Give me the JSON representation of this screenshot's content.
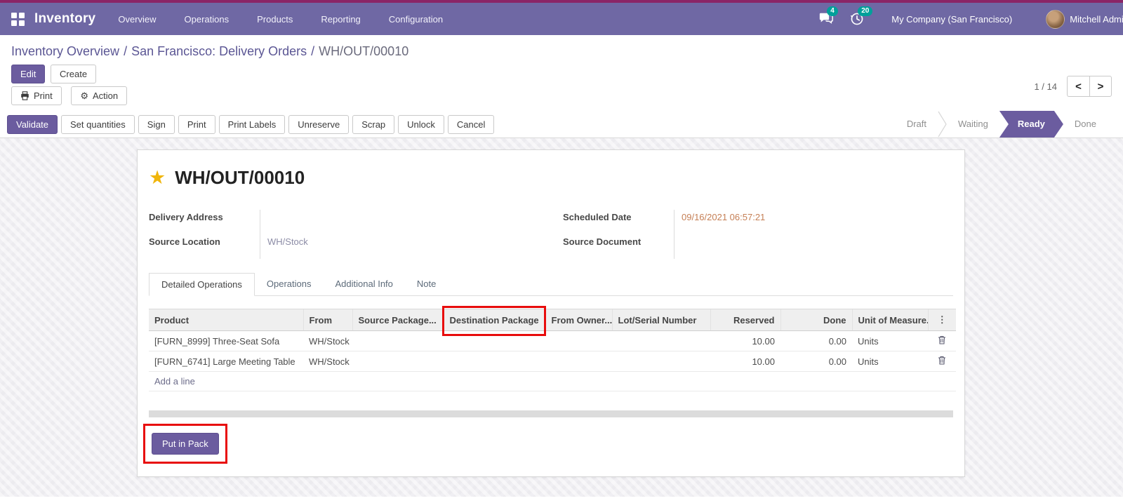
{
  "nav": {
    "app_name": "Inventory",
    "items": [
      "Overview",
      "Operations",
      "Products",
      "Reporting",
      "Configuration"
    ],
    "messages_count": "4",
    "activities_count": "20",
    "company": "My Company (San Francisco)",
    "user": "Mitchell Admin"
  },
  "breadcrumb": {
    "link1": "Inventory Overview",
    "link2": "San Francisco: Delivery Orders",
    "active": "WH/OUT/00010",
    "separator": "/"
  },
  "control": {
    "edit": "Edit",
    "create": "Create",
    "print": "Print",
    "action": "Action",
    "pager_count": "1 / 14"
  },
  "statusbar": {
    "buttons": [
      "Validate",
      "Set quantities",
      "Sign",
      "Print",
      "Print Labels",
      "Unreserve",
      "Scrap",
      "Unlock",
      "Cancel"
    ],
    "stages": [
      {
        "label": "Draft",
        "state": "inactive"
      },
      {
        "label": "Waiting",
        "state": "inactive"
      },
      {
        "label": "Ready",
        "state": "active"
      },
      {
        "label": "Done",
        "state": "inactive"
      }
    ]
  },
  "sheet": {
    "title": "WH/OUT/00010",
    "fields": {
      "delivery_address_label": "Delivery Address",
      "delivery_address_value": "",
      "source_location_label": "Source Location",
      "source_location_value": "WH/Stock",
      "scheduled_date_label": "Scheduled Date",
      "scheduled_date_value": "09/16/2021 06:57:21",
      "source_document_label": "Source Document",
      "source_document_value": ""
    },
    "tabs": [
      "Detailed Operations",
      "Operations",
      "Additional Info",
      "Note"
    ],
    "table": {
      "columns": [
        "Product",
        "From",
        "Source Package...",
        "Destination Package",
        "From Owner...",
        "Lot/Serial Number",
        "Reserved",
        "Done",
        "Unit of Measure..."
      ],
      "rows": [
        {
          "product": "[FURN_8999] Three-Seat Sofa",
          "from": "WH/Stock",
          "source_package": "",
          "destination_package": "",
          "from_owner": "",
          "lot_serial": "",
          "reserved": "10.00",
          "done": "0.00",
          "uom": "Units"
        },
        {
          "product": "[FURN_6741] Large Meeting Table",
          "from": "WH/Stock",
          "source_package": "",
          "destination_package": "",
          "from_owner": "",
          "lot_serial": "",
          "reserved": "10.00",
          "done": "0.00",
          "uom": "Units"
        }
      ],
      "add_line": "Add a line"
    },
    "put_in_pack": "Put in Pack"
  },
  "colors": {
    "brand_stripe": "#8a2567",
    "navbar": "#6f68a4",
    "primary": "#6b5c9f",
    "badge": "#00a09a",
    "highlight": "#e80c0c",
    "date_text": "#c57f55",
    "star": "#f0b50a"
  }
}
